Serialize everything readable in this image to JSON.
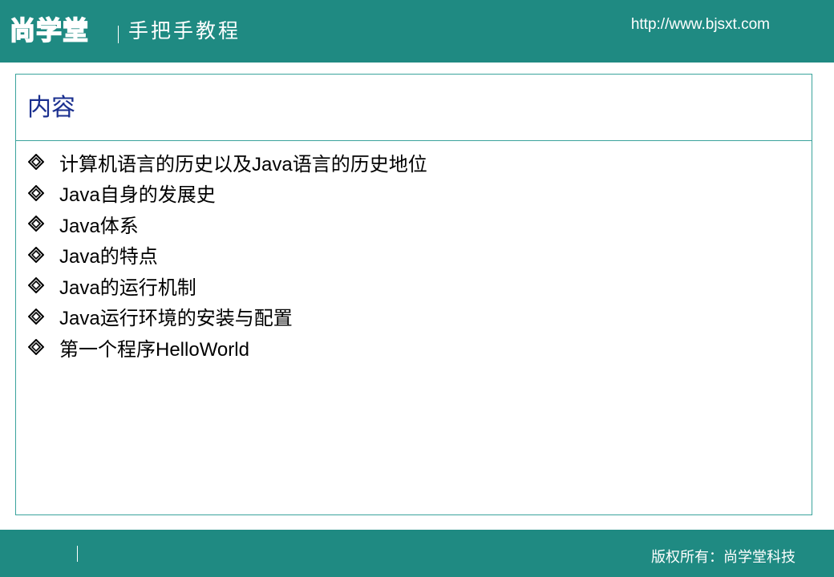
{
  "header": {
    "logo_text": "尚学堂",
    "tagline": "手把手教程",
    "url": "http://www.bjsxt.com"
  },
  "slide": {
    "title": "内容",
    "items": [
      "计算机语言的历史以及Java语言的历史地位",
      "Java自身的发展史",
      "Java体系",
      "Java的特点",
      "Java的运行机制",
      "Java运行环境的安装与配置",
      "第一个程序HelloWorld"
    ],
    "bullet_icon": "diamond-bullet-icon"
  },
  "footer": {
    "copyright": "版权所有：尚学堂科技"
  },
  "colors": {
    "brand_teal": "#1f8a82",
    "title_blue": "#1a2f8f",
    "panel_border": "#3aa39c"
  }
}
